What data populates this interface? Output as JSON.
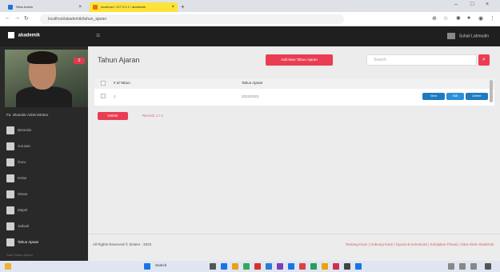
{
  "browser": {
    "tabs": [
      {
        "title": "Situs Admin"
      },
      {
        "title": "localhost / 127.0.0.1 / akademik",
        "active": true
      }
    ],
    "new_tab": "+",
    "url": "localhost/akademik/tahun_ajaran"
  },
  "topnav": {
    "brand": "akademik",
    "menu_icon": "hamburger-icon",
    "user": "Suhail Lahmudin"
  },
  "sidebar": {
    "badge": "0",
    "user_name": "Fa. Iskandar  Administrator",
    "items": [
      {
        "label": "Beranda",
        "icon": "home-icon"
      },
      {
        "label": "Jurusan",
        "icon": "calendar-icon"
      },
      {
        "label": "Guru",
        "icon": "person-icon"
      },
      {
        "label": "Kelas",
        "icon": "calendar-icon"
      },
      {
        "label": "Siswa",
        "icon": "calendar-icon"
      },
      {
        "label": "Mapel",
        "icon": "calendar-icon"
      },
      {
        "label": "Jadwal",
        "icon": "calendar-icon"
      },
      {
        "label": "Tahun Ajaran",
        "icon": "calendar-icon",
        "active": true
      }
    ],
    "bottom_text": "Data Tahun Ajaran"
  },
  "main": {
    "title": "Tahun Ajaran",
    "add_button": "Add New Tahun Ajaran",
    "search_placeholder": "Search",
    "table": {
      "columns": [
        "# Id Tahun",
        "Tahun Ajaran"
      ],
      "rows": [
        {
          "id": "1",
          "tahun": "2022/2023"
        }
      ],
      "row_actions": [
        "View",
        "Edit",
        "Delete"
      ]
    },
    "bulk_action": "Delete",
    "record_info": "Record: 1 / 1"
  },
  "footer": {
    "copyright": "All Rights Reserved © Sistem - 2023",
    "links": "Tentang Kami  |  Hubungi Kami  |  Syarat & Ketentuan  |  Kebijakan Privasi  |  Situs Web Akademik"
  },
  "taskbar": {
    "search": "Search"
  },
  "colors": {
    "accent": "#ea3d52",
    "topnav": "#1f1f1f",
    "sidebar": "#292929",
    "action_blue": "#1f7bbf"
  }
}
